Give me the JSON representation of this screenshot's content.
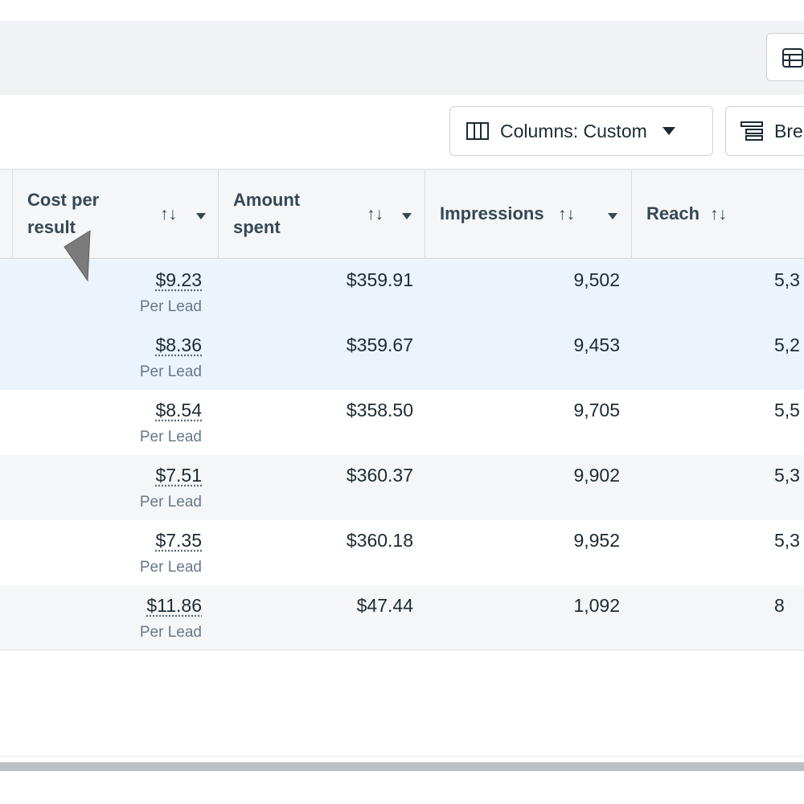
{
  "toolbar": {
    "table_view_icon": "table-icon",
    "columns_label": "Columns: Custom",
    "columns_icon": "columns-icon",
    "breakdown_label": "Bre",
    "breakdown_icon": "breakdown-icon"
  },
  "table": {
    "headers": [
      {
        "label_line1": "Cost per",
        "label_line2": "result",
        "sort": "↑↓"
      },
      {
        "label_line1": "Amount",
        "label_line2": "spent",
        "sort": "↑↓"
      },
      {
        "label": "Impressions",
        "sort": "↑↓"
      },
      {
        "label": "Reach",
        "sort": "↑↓"
      }
    ],
    "rows": [
      {
        "cost_per_result": "$9.23",
        "result_type": "Per Lead",
        "amount_spent": "$359.91",
        "impressions": "9,502",
        "reach": "5,3"
      },
      {
        "cost_per_result": "$8.36",
        "result_type": "Per Lead",
        "amount_spent": "$359.67",
        "impressions": "9,453",
        "reach": "5,2"
      },
      {
        "cost_per_result": "$8.54",
        "result_type": "Per Lead",
        "amount_spent": "$358.50",
        "impressions": "9,705",
        "reach": "5,5"
      },
      {
        "cost_per_result": "$7.51",
        "result_type": "Per Lead",
        "amount_spent": "$360.37",
        "impressions": "9,902",
        "reach": "5,3"
      },
      {
        "cost_per_result": "$7.35",
        "result_type": "Per Lead",
        "amount_spent": "$360.18",
        "impressions": "9,952",
        "reach": "5,3"
      },
      {
        "cost_per_result": "$11.86",
        "result_type": "Per Lead",
        "amount_spent": "$47.44",
        "impressions": "1,092",
        "reach": "8"
      }
    ]
  },
  "colors": {
    "selected_row": "#ebf3fc",
    "alt_row": "#f5f6f7",
    "border": "#dadde1"
  }
}
